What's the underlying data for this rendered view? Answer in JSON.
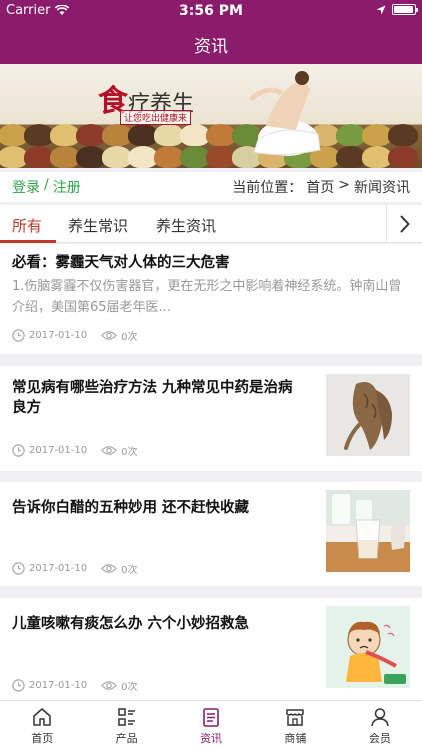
{
  "status_bar": {
    "carrier": "Carrier",
    "time": "3:56 PM",
    "battery_level": 0.95
  },
  "nav": {
    "title": "资讯"
  },
  "banner": {
    "logo_main": "食",
    "logo_rest": "疗养生",
    "subtitle": "让您吃出健康来"
  },
  "location_bar": {
    "login": "登录",
    "separator": "/",
    "register": "注册",
    "current_label": "当前位置：",
    "home": "首页",
    "arrow": ">",
    "current": "新闻资讯"
  },
  "tabs": {
    "items": [
      {
        "label": "所有"
      },
      {
        "label": "养生常识"
      },
      {
        "label": "养生资讯"
      }
    ],
    "active": "所有"
  },
  "articles": [
    {
      "title": "必看：雾霾天气对人体的三大危害",
      "summary": "1.伤脑雾霾不仅伤害器官，更在无形之中影响着神经系统。钟南山曾介绍，美国第65届老年医...",
      "date": "2017-01-10",
      "views": "0次"
    },
    {
      "title": "常见病有哪些治疗方法 九种常见中药是治病良方",
      "date": "2017-01-10",
      "views": "0次",
      "thumb": "ginseng-root-image"
    },
    {
      "title": "告诉你白醋的五种妙用 还不赶快收藏",
      "date": "2017-01-10",
      "views": "0次",
      "thumb": "vinegar-glass-image"
    },
    {
      "title": "儿童咳嗽有痰怎么办 六个小妙招救急",
      "date": "2017-01-10",
      "views": "0次",
      "thumb": "coughing-child-illustration"
    }
  ],
  "tabbar": {
    "items": [
      {
        "label": "首页",
        "icon": "home-icon"
      },
      {
        "label": "产品",
        "icon": "product-list-icon"
      },
      {
        "label": "资讯",
        "icon": "news-icon"
      },
      {
        "label": "商铺",
        "icon": "shop-icon"
      },
      {
        "label": "会员",
        "icon": "member-icon"
      }
    ],
    "active": "资讯"
  },
  "colors": {
    "brand": "#8b1b6b",
    "accent_red": "#c0392b",
    "login_green": "#2ea44a"
  }
}
